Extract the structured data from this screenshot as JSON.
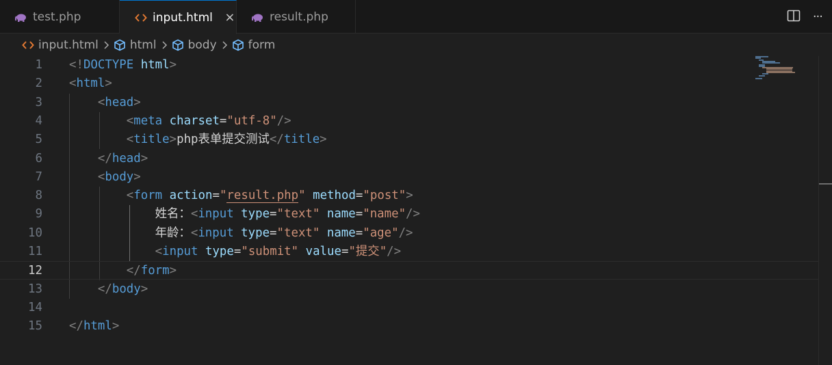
{
  "tabs": [
    {
      "label": "test.php",
      "icon": "php-elephant-icon",
      "active": false
    },
    {
      "label": "input.html",
      "icon": "html-brackets-icon",
      "active": true,
      "close": "×"
    },
    {
      "label": "result.php",
      "icon": "php-elephant-icon",
      "active": false
    }
  ],
  "tab_actions": {
    "split": "split-editor-icon",
    "more": "···"
  },
  "breadcrumb": [
    {
      "label": "input.html",
      "icon": "html-brackets-icon"
    },
    {
      "label": "html",
      "icon": "element-cube-icon"
    },
    {
      "label": "body",
      "icon": "element-cube-icon"
    },
    {
      "label": "form",
      "icon": "element-cube-icon"
    }
  ],
  "editor": {
    "current_line": 12,
    "line_numbers": [
      "1",
      "2",
      "3",
      "4",
      "5",
      "6",
      "7",
      "8",
      "9",
      "10",
      "11",
      "12",
      "13",
      "14",
      "15"
    ],
    "lines": [
      [
        [
          "p",
          "<!"
        ],
        [
          "t",
          "DOCTYPE"
        ],
        [
          "x",
          " "
        ],
        [
          "a",
          "html"
        ],
        [
          "p",
          ">"
        ]
      ],
      [
        [
          "p",
          "<"
        ],
        [
          "t",
          "html"
        ],
        [
          "p",
          ">"
        ]
      ],
      [
        [
          "x",
          "    "
        ],
        [
          "p",
          "<"
        ],
        [
          "t",
          "head"
        ],
        [
          "p",
          ">"
        ]
      ],
      [
        [
          "x",
          "        "
        ],
        [
          "p",
          "<"
        ],
        [
          "t",
          "meta"
        ],
        [
          "x",
          " "
        ],
        [
          "a",
          "charset"
        ],
        [
          "x",
          "="
        ],
        [
          "s",
          "\"utf-8\""
        ],
        [
          "p",
          "/>"
        ]
      ],
      [
        [
          "x",
          "        "
        ],
        [
          "p",
          "<"
        ],
        [
          "t",
          "title"
        ],
        [
          "p",
          ">"
        ],
        [
          "x",
          "php表单提交测试"
        ],
        [
          "p",
          "</"
        ],
        [
          "t",
          "title"
        ],
        [
          "p",
          ">"
        ]
      ],
      [
        [
          "x",
          "    "
        ],
        [
          "p",
          "</"
        ],
        [
          "t",
          "head"
        ],
        [
          "p",
          ">"
        ]
      ],
      [
        [
          "x",
          "    "
        ],
        [
          "p",
          "<"
        ],
        [
          "t",
          "body"
        ],
        [
          "p",
          ">"
        ]
      ],
      [
        [
          "x",
          "        "
        ],
        [
          "p",
          "<"
        ],
        [
          "t",
          "form"
        ],
        [
          "x",
          " "
        ],
        [
          "a",
          "action"
        ],
        [
          "x",
          "="
        ],
        [
          "s",
          "\""
        ],
        [
          "link",
          "result.php"
        ],
        [
          "s",
          "\""
        ],
        [
          "x",
          " "
        ],
        [
          "a",
          "method"
        ],
        [
          "x",
          "="
        ],
        [
          "s",
          "\"post\""
        ],
        [
          "p",
          ">"
        ]
      ],
      [
        [
          "x",
          "            姓名："
        ],
        [
          "p",
          "<"
        ],
        [
          "t",
          "input"
        ],
        [
          "x",
          " "
        ],
        [
          "a",
          "type"
        ],
        [
          "x",
          "="
        ],
        [
          "s",
          "\"text\""
        ],
        [
          "x",
          " "
        ],
        [
          "a",
          "name"
        ],
        [
          "x",
          "="
        ],
        [
          "s",
          "\"name\""
        ],
        [
          "p",
          "/>"
        ]
      ],
      [
        [
          "x",
          "            年龄："
        ],
        [
          "p",
          "<"
        ],
        [
          "t",
          "input"
        ],
        [
          "x",
          " "
        ],
        [
          "a",
          "type"
        ],
        [
          "x",
          "="
        ],
        [
          "s",
          "\"text\""
        ],
        [
          "x",
          " "
        ],
        [
          "a",
          "name"
        ],
        [
          "x",
          "="
        ],
        [
          "s",
          "\"age\""
        ],
        [
          "p",
          "/>"
        ]
      ],
      [
        [
          "x",
          "            "
        ],
        [
          "p",
          "<"
        ],
        [
          "t",
          "input"
        ],
        [
          "x",
          " "
        ],
        [
          "a",
          "type"
        ],
        [
          "x",
          "="
        ],
        [
          "s",
          "\"submit\""
        ],
        [
          "x",
          " "
        ],
        [
          "a",
          "value"
        ],
        [
          "x",
          "="
        ],
        [
          "s",
          "\"提交\""
        ],
        [
          "p",
          "/>"
        ]
      ],
      [
        [
          "x",
          "        "
        ],
        [
          "p",
          "</"
        ],
        [
          "t",
          "form"
        ],
        [
          "p",
          ">"
        ]
      ],
      [
        [
          "x",
          "    "
        ],
        [
          "p",
          "</"
        ],
        [
          "t",
          "body"
        ],
        [
          "p",
          ">"
        ]
      ],
      [],
      [
        [
          "p",
          "</"
        ],
        [
          "t",
          "html"
        ],
        [
          "p",
          ">"
        ]
      ]
    ]
  },
  "colors": {
    "php_icon": "#a074c4",
    "html_icon": "#e37933",
    "cube_icon": "#75beff",
    "tag": "#569cd6",
    "attribute": "#9cdcfe",
    "string": "#ce9178",
    "punctuation": "#808080"
  }
}
